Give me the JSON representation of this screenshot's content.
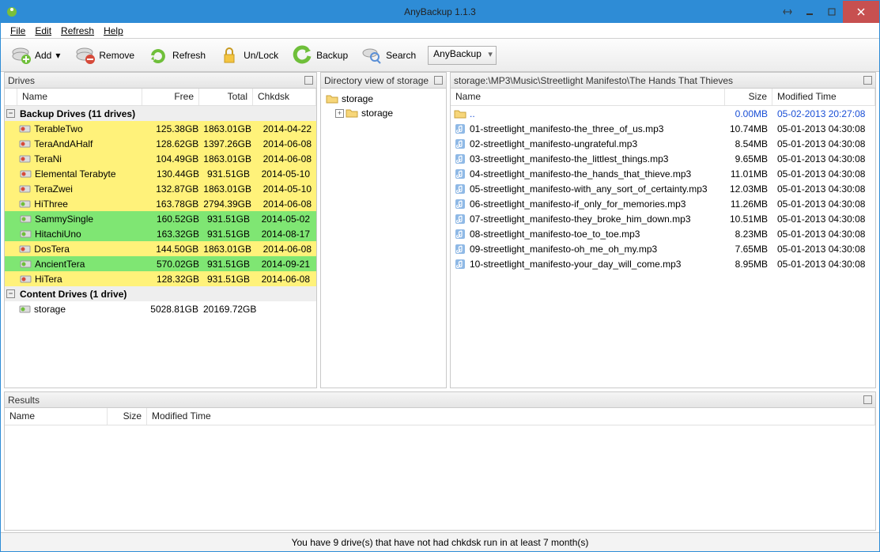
{
  "window": {
    "title": "AnyBackup 1.1.3"
  },
  "menu": {
    "file": "File",
    "edit": "Edit",
    "refresh": "Refresh",
    "help": "Help"
  },
  "toolbar": {
    "add": "Add",
    "remove": "Remove",
    "refresh": "Refresh",
    "unlock": "Un/Lock",
    "backup": "Backup",
    "search": "Search",
    "selector": "AnyBackup"
  },
  "panels": {
    "drives": {
      "title": "Drives",
      "cols": {
        "name": "Name",
        "free": "Free",
        "total": "Total",
        "chkdsk": "Chkdsk"
      },
      "group_backup": "Backup Drives (11 drives)",
      "group_content": "Content Drives (1 drive)",
      "backup": [
        {
          "name": "TerableTwo",
          "free": "125.38GB",
          "total": "1863.01GB",
          "chk": "2014-04-22",
          "hl": "y",
          "ic": "r"
        },
        {
          "name": "TeraAndAHalf",
          "free": "128.62GB",
          "total": "1397.26GB",
          "chk": "2014-06-08",
          "hl": "y",
          "ic": "r"
        },
        {
          "name": "TeraNi",
          "free": "104.49GB",
          "total": "1863.01GB",
          "chk": "2014-06-08",
          "hl": "y",
          "ic": "r"
        },
        {
          "name": "Elemental Terabyte",
          "free": "130.44GB",
          "total": "931.51GB",
          "chk": "2014-05-10",
          "hl": "y",
          "ic": "r"
        },
        {
          "name": "TeraZwei",
          "free": "132.87GB",
          "total": "1863.01GB",
          "chk": "2014-05-10",
          "hl": "y",
          "ic": "r"
        },
        {
          "name": "HiThree",
          "free": "163.78GB",
          "total": "2794.39GB",
          "chk": "2014-06-08",
          "hl": "y",
          "ic": "g"
        },
        {
          "name": "SammySingle",
          "free": "160.52GB",
          "total": "931.51GB",
          "chk": "2014-05-02",
          "hl": "g",
          "ic": "g"
        },
        {
          "name": "HitachiUno",
          "free": "163.32GB",
          "total": "931.51GB",
          "chk": "2014-08-17",
          "hl": "g",
          "ic": "g"
        },
        {
          "name": "DosTera",
          "free": "144.50GB",
          "total": "1863.01GB",
          "chk": "2014-06-08",
          "hl": "y",
          "ic": "r"
        },
        {
          "name": "AncientTera",
          "free": "570.02GB",
          "total": "931.51GB",
          "chk": "2014-09-21",
          "hl": "g",
          "ic": "g"
        },
        {
          "name": "HiTera",
          "free": "128.32GB",
          "total": "931.51GB",
          "chk": "2014-06-08",
          "hl": "y",
          "ic": "r"
        }
      ],
      "content": [
        {
          "name": "storage",
          "free": "5028.81GB",
          "total": "20169.72GB",
          "chk": "",
          "hl": "w",
          "ic": "g"
        }
      ]
    },
    "tree": {
      "title": "Directory view of storage",
      "root": "storage",
      "child": "storage"
    },
    "files": {
      "path": "storage:\\MP3\\Music\\Streetlight Manifesto\\The Hands That Thieves",
      "cols": {
        "name": "Name",
        "size": "Size",
        "mod": "Modified Time"
      },
      "up": {
        "name": "..",
        "size": "0.00MB",
        "mod": "05-02-2013 20:27:08"
      },
      "rows": [
        {
          "name": "01-streetlight_manifesto-the_three_of_us.mp3",
          "size": "10.74MB",
          "mod": "05-01-2013 04:30:08"
        },
        {
          "name": "02-streetlight_manifesto-ungrateful.mp3",
          "size": "8.54MB",
          "mod": "05-01-2013 04:30:08"
        },
        {
          "name": "03-streetlight_manifesto-the_littlest_things.mp3",
          "size": "9.65MB",
          "mod": "05-01-2013 04:30:08"
        },
        {
          "name": "04-streetlight_manifesto-the_hands_that_thieve.mp3",
          "size": "11.01MB",
          "mod": "05-01-2013 04:30:08"
        },
        {
          "name": "05-streetlight_manifesto-with_any_sort_of_certainty.mp3",
          "size": "12.03MB",
          "mod": "05-01-2013 04:30:08"
        },
        {
          "name": "06-streetlight_manifesto-if_only_for_memories.mp3",
          "size": "11.26MB",
          "mod": "05-01-2013 04:30:08"
        },
        {
          "name": "07-streetlight_manifesto-they_broke_him_down.mp3",
          "size": "10.51MB",
          "mod": "05-01-2013 04:30:08"
        },
        {
          "name": "08-streetlight_manifesto-toe_to_toe.mp3",
          "size": "8.23MB",
          "mod": "05-01-2013 04:30:08"
        },
        {
          "name": "09-streetlight_manifesto-oh_me_oh_my.mp3",
          "size": "7.65MB",
          "mod": "05-01-2013 04:30:08"
        },
        {
          "name": "10-streetlight_manifesto-your_day_will_come.mp3",
          "size": "8.95MB",
          "mod": "05-01-2013 04:30:08"
        }
      ]
    },
    "results": {
      "title": "Results",
      "cols": {
        "name": "Name",
        "size": "Size",
        "mod": "Modified Time"
      }
    }
  },
  "status": "You have 9 drive(s) that have not had chkdsk run in at least 7 month(s)"
}
